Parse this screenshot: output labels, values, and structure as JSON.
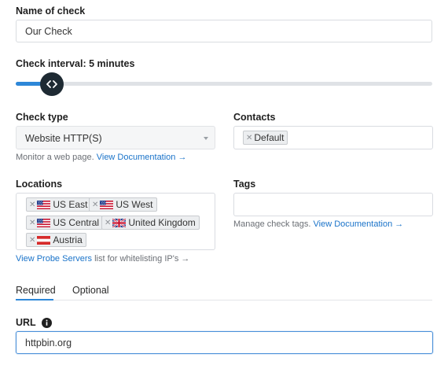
{
  "name_field": {
    "label": "Name of check",
    "value": "Our Check"
  },
  "interval": {
    "label": "Check interval: 5 minutes",
    "position_fraction": 0.1
  },
  "check_type": {
    "label": "Check type",
    "selected": "Website HTTP(S)",
    "help_text": "Monitor a web page.",
    "help_link": "View Documentation →"
  },
  "contacts": {
    "label": "Contacts",
    "tags": [
      "Default"
    ]
  },
  "locations": {
    "label": "Locations",
    "tags": [
      "US East",
      "US West",
      "US Central",
      "United Kingdom",
      "Austria"
    ],
    "footer_link": "View Probe Servers",
    "footer_text": "list for whitelisting IP's →"
  },
  "tags": {
    "label": "Tags",
    "help_text": "Manage check tags.",
    "help_link": "View Documentation →"
  },
  "tabs": [
    {
      "label": "Required",
      "active": true
    },
    {
      "label": "Optional",
      "active": false
    }
  ],
  "url_field": {
    "label": "URL",
    "value": "httpbin.org"
  },
  "icons": {
    "slider_handle": "chevrons-left-right-icon",
    "url_info": "info-icon",
    "tag_remove": "close-icon",
    "dropdown": "caret-down-icon"
  },
  "colors": {
    "accent": "#1a73c9",
    "slider_fill": "#2d87d8",
    "slider_handle": "#1e2a33",
    "active_tab": "#2d87d8"
  }
}
